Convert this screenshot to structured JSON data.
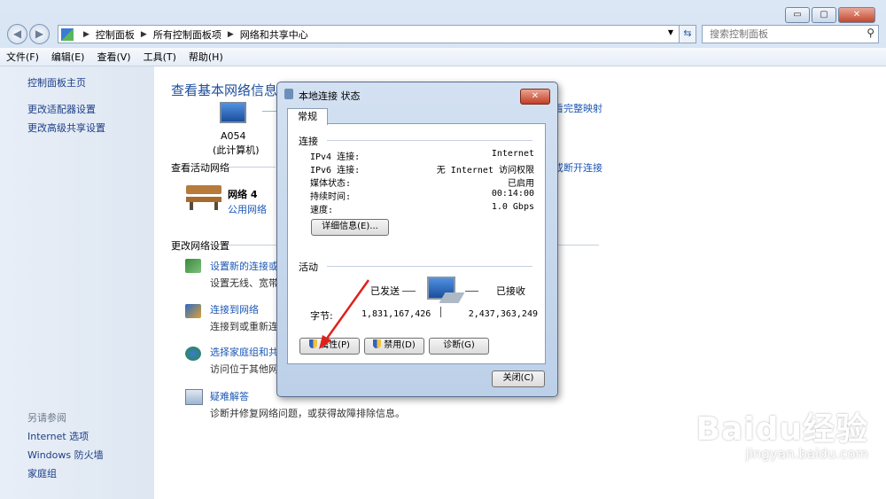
{
  "window_controls": {
    "minimize": "▭",
    "maximize": "▢",
    "close": "✕"
  },
  "address": {
    "crumbs": [
      "控制面板",
      "所有控制面板项",
      "网络和共享中心"
    ],
    "search_placeholder": "搜索控制面板"
  },
  "menu": [
    "文件(F)",
    "编辑(E)",
    "查看(V)",
    "工具(T)",
    "帮助(H)"
  ],
  "sidebar": {
    "items": [
      "控制面板主页",
      "更改适配器设置",
      "更改高级共享设置"
    ],
    "see_also_heading": "另请参阅",
    "see_also": [
      "Internet 选项",
      "Windows 防火墙",
      "家庭组"
    ]
  },
  "main": {
    "title": "查看基本网络信息并",
    "computer_name": "A054",
    "computer_sub": "(此计算机)",
    "full_map_link": "看完整映射",
    "active_heading": "查看活动网络",
    "disconnect_link": "或断开连接",
    "network_name": "网络  4",
    "network_type": "公用网络",
    "change_heading": "更改网络设置",
    "settings": [
      {
        "title": "设置新的连接或网",
        "desc": "设置无线、宽带、"
      },
      {
        "title": "连接到网络",
        "desc": "连接到或重新连接"
      },
      {
        "title": "选择家庭组和共享",
        "desc": "访问位于其他网络"
      },
      {
        "title": "疑难解答",
        "desc": "诊断并修复网络问题，或获得故障排除信息。"
      }
    ]
  },
  "dialog": {
    "title": "本地连接 状态",
    "tab": "常规",
    "connection_heading": "连接",
    "rows": [
      {
        "label": "IPv4 连接:",
        "value": "Internet"
      },
      {
        "label": "IPv6 连接:",
        "value": "无 Internet 访问权限"
      },
      {
        "label": "媒体状态:",
        "value": "已启用"
      },
      {
        "label": "持续时间:",
        "value": "00:14:00"
      },
      {
        "label": "速度:",
        "value": "1.0 Gbps"
      }
    ],
    "details_button": "详细信息(E)...",
    "activity_heading": "活动",
    "sent_label": "已发送",
    "received_label": "已接收",
    "bytes_label": "字节:",
    "bytes_sent": "1,831,167,426",
    "bytes_received": "2,437,363,249",
    "properties_button": "属性(P)",
    "disable_button": "禁用(D)",
    "diagnose_button": "诊断(G)",
    "close_button": "关闭(C)"
  },
  "watermark": {
    "logo": "Baidu经验",
    "url": "jingyan.baidu.com"
  }
}
